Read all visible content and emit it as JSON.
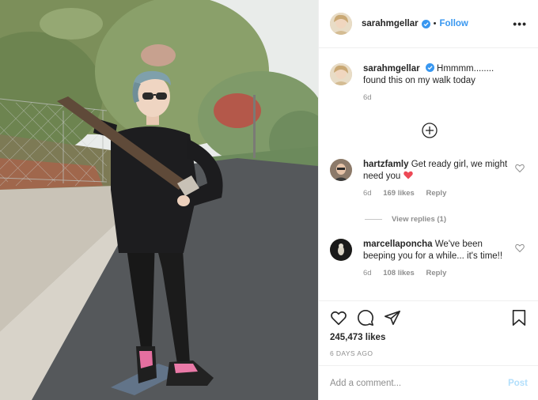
{
  "colors": {
    "accent": "#3897f0",
    "verified": "#3897f0",
    "muted": "#8e8e8e",
    "heart": "#ed4956"
  },
  "header": {
    "username": "sarahmgellar",
    "separator": "•",
    "follow_label": "Follow",
    "more_label": "•••",
    "icons": {
      "verified": "verified-badge-icon",
      "more": "more-options-icon"
    }
  },
  "caption": {
    "username": "sarahmgellar",
    "text": "Hmmmm........ found this on my walk today",
    "time": "6d"
  },
  "load_more": {
    "icon": "plus-circle-icon"
  },
  "comments": [
    {
      "username": "hartzfamly",
      "text": "Get ready girl, we might need you",
      "emoji": "red-heart-icon",
      "time": "6d",
      "likes": "169 likes",
      "reply_label": "Reply"
    },
    {
      "username": "marcellaponcha",
      "text": "We've been beeping you for a while... it's time!!",
      "time": "6d",
      "likes": "108 likes",
      "reply_label": "Reply"
    }
  ],
  "view_replies": "View replies (1)",
  "actions": {
    "icons": [
      "like-heart-icon",
      "comment-icon",
      "share-icon",
      "bookmark-icon"
    ],
    "likes": "245,473 likes",
    "date": "6 DAYS AGO"
  },
  "add_comment": {
    "placeholder": "Add a comment...",
    "post_label": "Post"
  }
}
